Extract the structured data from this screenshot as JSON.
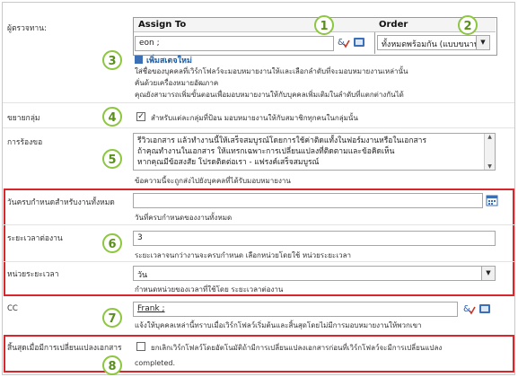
{
  "fields": {
    "participants_label": "ผู้ตรวจทาน:",
    "assign_header": "Assign To",
    "order_header": "Order",
    "assignee_value": "eon ;",
    "order_value": "ทั้งหมดพร้อมกัน (แบบขนาน)",
    "add_stage_link": "เพิ่มสเตจใหม่",
    "assign_hint_1": "ใส่ชื่อของบุคคลที่เวิร์กโฟลว์จะมอบหมายงานให้และเลือกลำดับที่จะมอบหมายงานเหล่านั้น",
    "assign_hint_2": "คั่นด้วยเครื่องหมายอัฒภาค",
    "assign_hint_3": "คุณยังสามารถเพิ่มขั้นตอนเพื่อมอบหมายงานให้กับบุคคลเพิ่มเติมในลำดับที่แตกต่างกันได้",
    "expand_label": "ขยายกลุ่ม",
    "expand_checkbox_text": "สำหรับแต่ละกลุ่มที่ป้อน มอบหมายงานให้กับสมาชิกทุกคนในกลุ่มนั้น",
    "request_label": "การร้องขอ",
    "request_line_1": "รีวิวเอกสาร แล้วทำงานนี้ให้เสร็จสมบูรณ์โดยการใช้ค่าติดแทั้งในฟอร์มงานหรือในเอกสาร",
    "request_line_2": "ถ้าคุณทำงานในเอกสาร ให้แทรกเฉพาะการเปลี่ยนแปลงที่ติดตามและข้อคิดเห็น",
    "request_line_3": "หากคุณมีข้อสงสัย โปรดติดต่อเรา - แฟรงค์เสร็จสมบูรณ์",
    "request_hint": "ข้อความนี้จะถูกส่งไปยังบุคคลที่ได้รับมอบหมายงาน",
    "due_all_label": "วันครบกำหนดสำหรับงานทั้งหมด",
    "due_all_hint": "วันที่ครบกำหนดของงานทั้งหมด",
    "duration_label": "ระยะเวลาต่องาน",
    "duration_value": "3",
    "duration_hint": "ระยะเวลาจนกว่างานจะครบกำหนด เลือกหน่วยโดยใช้ หน่วยระยะเวลา",
    "duration_unit_label": "หน่วยระยะเวลา",
    "duration_unit_value": "วัน",
    "duration_unit_hint": "กำหนดหน่วยของเวลาที่ใช้โดย ระยะเวลาต่องาน",
    "cc_label": "CC",
    "cc_value": "Frank ;",
    "cc_hint": "แจ้งให้บุคคลเหล่านี้ทราบเมื่อเวิร์กโฟลว์เริ่มต้นและสิ้นสุดโดยไม่มีการมอบหมายงานให้พวกเขา",
    "end_label": "สิ้นสุดเมื่อมีการเปลี่ยนแปลงเอกสาร",
    "end_checkbox_text": "ยกเลิกเวิร์กโฟลว์โดยอัตโนมัติถ้ามีการเปลี่ยนแปลงเอกสารก่อนที่เวิร์กโฟลว์จะมีการเปลี่ยนแปลง",
    "end_checkbox_text_2": "completed."
  },
  "callouts": [
    "1",
    "2",
    "3",
    "4",
    "5",
    "6",
    "7",
    "8"
  ],
  "colors": {
    "callout_border": "#8dc63f",
    "highlight_box": "#d9262a",
    "link": "#1f5fa8"
  },
  "icons": [
    "check-names-icon",
    "address-book-icon",
    "calendar-icon",
    "dropdown-arrow-icon",
    "add-stage-icon",
    "scroll-up-icon",
    "scroll-down-icon"
  ]
}
